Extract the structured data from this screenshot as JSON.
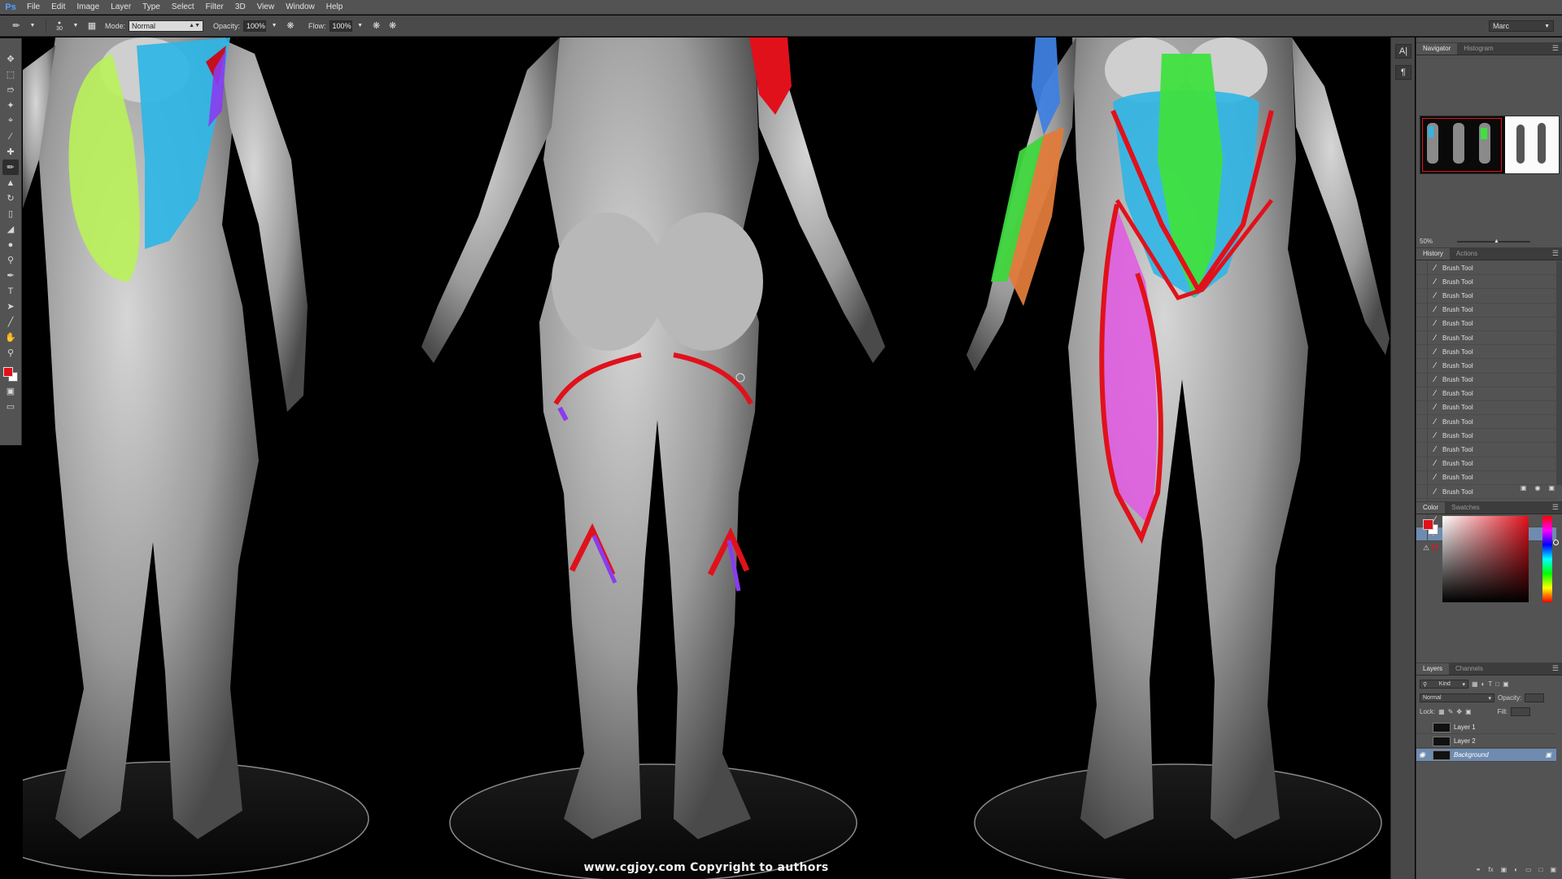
{
  "app": {
    "logo": "Ps",
    "menu": [
      "File",
      "Edit",
      "Image",
      "Layer",
      "Type",
      "Select",
      "Filter",
      "3D",
      "View",
      "Window",
      "Help"
    ]
  },
  "options_bar": {
    "brush_size": "30",
    "mode_label": "Mode:",
    "mode_value": "Normal",
    "opacity_label": "Opacity:",
    "opacity_value": "100%",
    "flow_label": "Flow:",
    "flow_value": "100%",
    "workspace": "Marc"
  },
  "tools": [
    "move-tool-icon",
    "marquee-tool-icon",
    "lasso-tool-icon",
    "quick-select-tool-icon",
    "crop-tool-icon",
    "eyedropper-tool-icon",
    "healing-brush-tool-icon",
    "brush-tool-icon",
    "clone-stamp-tool-icon",
    "history-brush-tool-icon",
    "eraser-tool-icon",
    "paint-bucket-tool-icon",
    "blur-tool-icon",
    "dodge-tool-icon",
    "pen-tool-icon",
    "type-tool-icon",
    "path-select-tool-icon",
    "shape-tool-icon",
    "hand-tool-icon",
    "zoom-tool-icon"
  ],
  "colors": {
    "foreground": "#e0111b",
    "background": "#ffffff",
    "selection": "#6f8bb0"
  },
  "canvas": {
    "watermark": "www.cgjoy.com  Copyright to authors"
  },
  "navigator": {
    "tabs": [
      "Navigator",
      "Histogram"
    ],
    "zoom": "50%"
  },
  "history": {
    "tabs": [
      "History",
      "Actions"
    ],
    "items": [
      "Brush Tool",
      "Brush Tool",
      "Brush Tool",
      "Brush Tool",
      "Brush Tool",
      "Brush Tool",
      "Brush Tool",
      "Brush Tool",
      "Brush Tool",
      "Brush Tool",
      "Brush Tool",
      "Brush Tool",
      "Brush Tool",
      "Brush Tool",
      "Brush Tool",
      "Brush Tool",
      "Brush Tool",
      "Brush Tool",
      "Brush Tool",
      "Brush Tool"
    ]
  },
  "color_panel": {
    "tabs": [
      "Color",
      "Swatches"
    ]
  },
  "layers": {
    "tabs": [
      "Layers",
      "Channels"
    ],
    "filter_kind": "Kind",
    "blend_mode": "Normal",
    "opacity_label": "Opacity:",
    "lock_label": "Lock:",
    "fill_label": "Fill:",
    "items": [
      {
        "name": "Layer 1",
        "visible": false,
        "active": false
      },
      {
        "name": "Layer 2",
        "visible": false,
        "active": false
      },
      {
        "name": "Background",
        "visible": true,
        "active": true
      }
    ]
  }
}
